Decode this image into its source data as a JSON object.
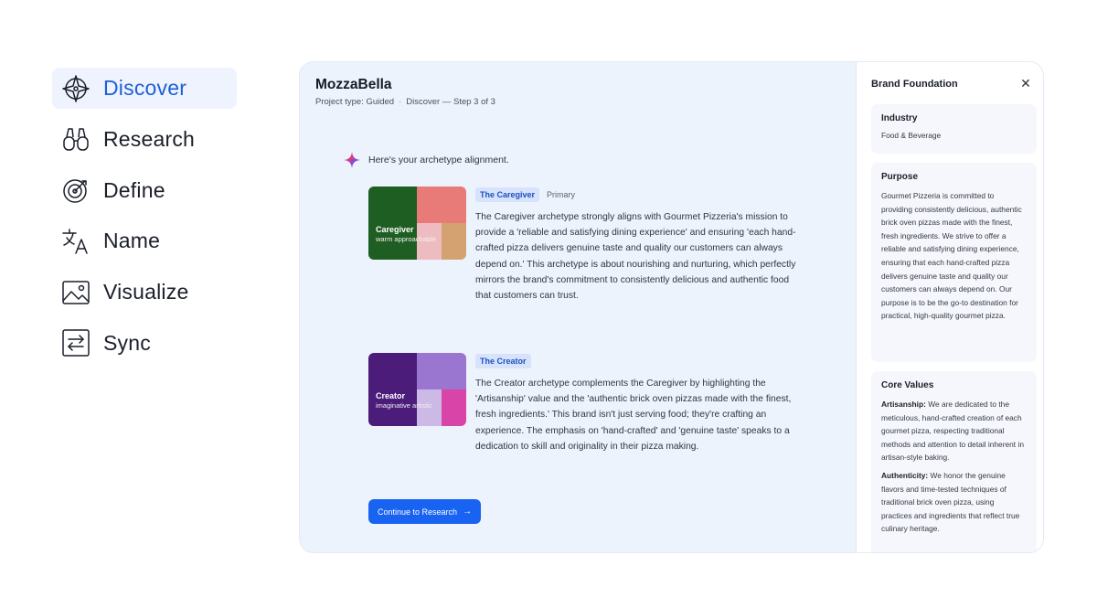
{
  "nav": {
    "items": [
      {
        "label": "Discover",
        "icon": "compass-icon",
        "active": true
      },
      {
        "label": "Research",
        "icon": "binoculars-icon"
      },
      {
        "label": "Define",
        "icon": "target-icon"
      },
      {
        "label": "Name",
        "icon": "translate-icon"
      },
      {
        "label": "Visualize",
        "icon": "image-icon"
      },
      {
        "label": "Sync",
        "icon": "sync-icon"
      }
    ]
  },
  "project": {
    "title": "MozzaBella",
    "type": "Project type: Guided",
    "step": "Discover — Step 3 of 3"
  },
  "assistant": {
    "intro": "Here's your archetype alignment."
  },
  "archetypes": [
    {
      "swatch_name": "Caregiver",
      "swatch_traits": "warm approachable",
      "tag": "The Caregiver",
      "badge": "Primary",
      "colors": [
        "#1f5e22",
        "#e87a78",
        "#eebcc0",
        "#d4a270"
      ],
      "text": "The Caregiver archetype strongly aligns with Gourmet Pizzeria's mission to provide a 'reliable and satisfying dining experience' and ensuring 'each hand-crafted pizza delivers genuine taste and quality our customers can always depend on.' This archetype is about nourishing and nurturing, which perfectly mirrors the brand's commitment to consistently delicious and authentic food that customers can trust."
    },
    {
      "swatch_name": "Creator",
      "swatch_traits": "imaginative artistic",
      "tag": "The Creator",
      "badge": "",
      "colors": [
        "#4b1c7a",
        "#9b76d1",
        "#ccb9e6",
        "#d944a8"
      ],
      "text": "The Creator archetype complements the Caregiver by highlighting the 'Artisanship' value and the 'authentic brick oven pizzas made with the finest, fresh ingredients.' This brand isn't just serving food; they're crafting an experience. The emphasis on 'hand-crafted' and 'genuine taste' speaks to a dedication to skill and originality in their pizza making."
    }
  ],
  "cta": {
    "label": "Continue to Research",
    "icon": "arrow-right-icon"
  },
  "drawer": {
    "title": "Brand Foundation",
    "close_icon": "close-icon",
    "industry": {
      "heading": "Industry",
      "value": "Food & Beverage"
    },
    "purpose": {
      "heading": "Purpose",
      "text": "Gourmet Pizzeria is committed to providing consistently delicious, authentic brick oven pizzas made with the finest, fresh ingredients. We strive to offer a reliable and satisfying dining experience, ensuring that each hand-crafted pizza delivers genuine taste and quality our customers can always depend on. Our purpose is to be the go-to destination for practical, high-quality gourmet pizza."
    },
    "core_values": {
      "heading": "Core Values",
      "items": [
        {
          "name": "Artisanship:",
          "text": " We are dedicated to the meticulous, hand-crafted creation of each gourmet pizza, respecting traditional methods and attention to detail inherent in artisan-style baking."
        },
        {
          "name": "Authenticity:",
          "text": " We honor the genuine flavors and time-tested techniques of traditional brick oven pizza, using practices and ingredients that reflect true culinary heritage."
        }
      ]
    }
  },
  "colors": {
    "accent": "#1863f2",
    "nav_active_bg": "#eef3fd",
    "panel_bg": "#ecf3fd"
  }
}
